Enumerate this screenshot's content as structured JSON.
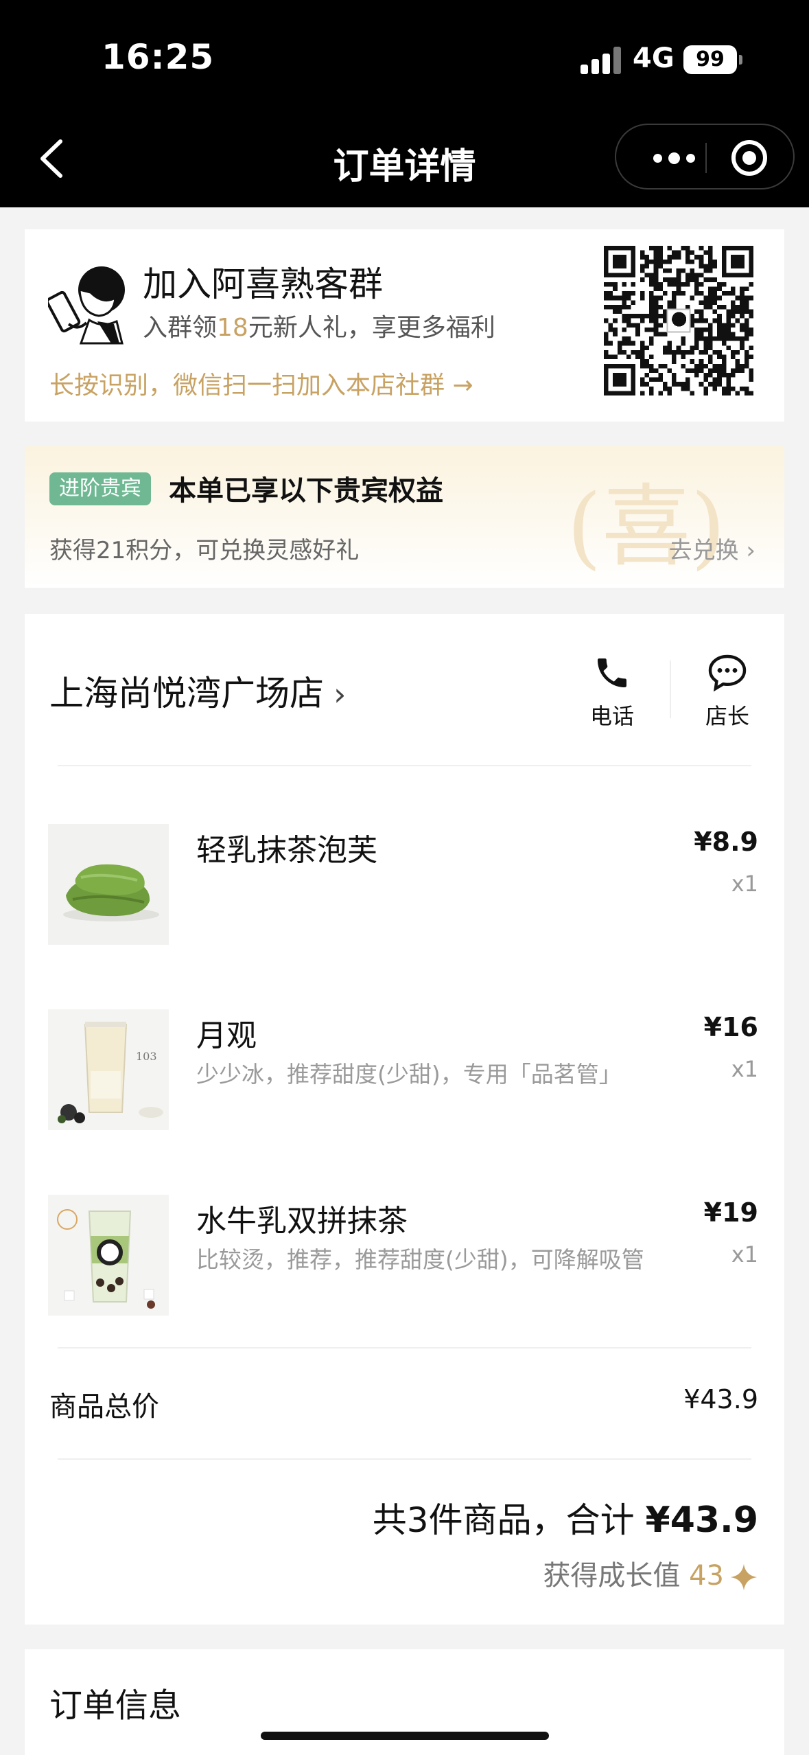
{
  "status_bar": {
    "time": "16:25",
    "network": "4G",
    "battery": "99"
  },
  "nav": {
    "title": "订单详情"
  },
  "group": {
    "title": "加入阿喜熟客群",
    "subtitle_pre": "入群领",
    "subtitle_amount": "18",
    "subtitle_post": "元新人礼，享更多福利",
    "link": "长按识别，微信扫一扫加入本店社群 →"
  },
  "vip": {
    "badge": "进阶贵宾",
    "title": "本单已享以下贵宾权益",
    "subtitle": "获得21积分，可兑换灵感好礼",
    "link": "去兑换 ›",
    "watermark": "(喜)"
  },
  "store": {
    "name": "上海尚悦湾广场店",
    "chevron": "›",
    "phone_label": "电话",
    "manager_label": "店长"
  },
  "items": [
    {
      "name": "轻乳抹茶泡芙",
      "desc": "",
      "price": "¥8.9",
      "qty": "x1"
    },
    {
      "name": "月观",
      "desc": "少少冰，推荐甜度(少甜)，专用「品茗管」",
      "price": "¥16",
      "qty": "x1"
    },
    {
      "name": "水牛乳双拼抹茶",
      "desc": "比较烫，推荐，推荐甜度(少甜)，可降解吸管",
      "price": "¥19",
      "qty": "x1"
    }
  ],
  "summary": {
    "goods_total_label": "商品总价",
    "goods_total_value": "¥43.9",
    "total_prefix": "共3件商品，合计 ",
    "total_value": "¥43.9",
    "growth_label": "获得成长值 ",
    "growth_value": "43"
  },
  "order_info": {
    "title": "订单信息"
  },
  "colors": {
    "accent_gold": "#c8a262",
    "vip_green": "#6fb893",
    "nav_bg": "#000000"
  }
}
